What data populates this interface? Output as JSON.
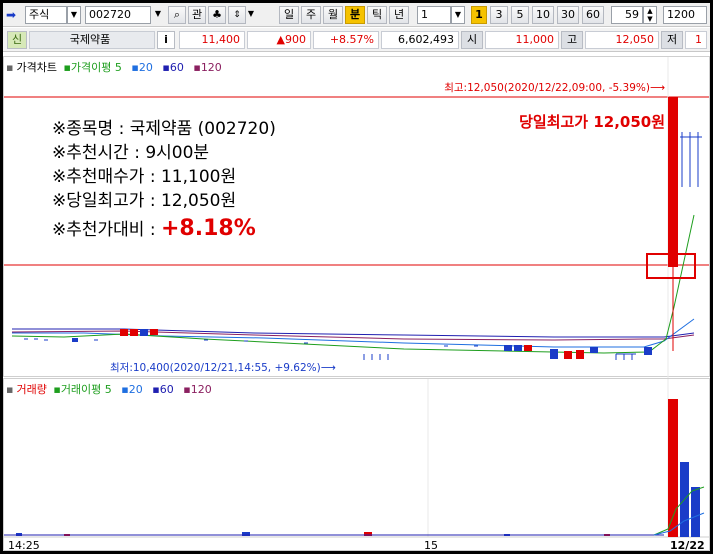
{
  "toolbar": {
    "market": "주식",
    "code": "002720",
    "watch_label": "관",
    "periods": [
      "일",
      "주",
      "월",
      "분",
      "틱",
      "년"
    ],
    "active_period": "분",
    "count_value": "1",
    "intervals": [
      "1",
      "3",
      "5",
      "10",
      "30",
      "60"
    ],
    "active_interval": "1",
    "spin_value": "59",
    "range_value": "1200"
  },
  "quote": {
    "badge": "신",
    "name": "국제약품",
    "info_label": "i",
    "price": "11,400",
    "change": "▲900",
    "change_pct": "+8.57%",
    "volume": "6,602,493",
    "open_label": "시",
    "open": "11,000",
    "high_label": "고",
    "high": "12,050",
    "low_label": "저",
    "low": "1"
  },
  "price_pane": {
    "legend": [
      "가격차트",
      "가격이평 5",
      "20",
      "60",
      "120"
    ],
    "legend_colors": [
      "#000000",
      "#1e9e1e",
      "#1f6fe0",
      "#2020b0",
      "#8b2060"
    ],
    "top_note": "당일최고가 12,050원",
    "high_note": "최고:12,050(2020/12/22,09:00, -5.39%)⟶",
    "low_note": "최저:10,400(2020/12/21,14:55, +9.62%)⟶",
    "info": {
      "line1": "※종목명 : 국제약품 (002720)",
      "line2": "※추천시간 : 9시00분",
      "line3": "※추천매수가 : 11,100원",
      "line4": "※당일최고가 : 12,050원",
      "line5_label": "※추천가대비 : ",
      "line5_value": "+8.18%"
    }
  },
  "volume_pane": {
    "legend": [
      "거래량",
      "거래이평 5",
      "20",
      "60",
      "120"
    ],
    "legend_colors": [
      "#e00000",
      "#1e9e1e",
      "#1f6fe0",
      "#2020b0",
      "#8b2060"
    ],
    "x_labels": [
      "14:25",
      "15",
      "12/22"
    ]
  },
  "colors": {
    "up": "#e00000",
    "down": "#1a3cc8",
    "accent": "#f5c200"
  }
}
